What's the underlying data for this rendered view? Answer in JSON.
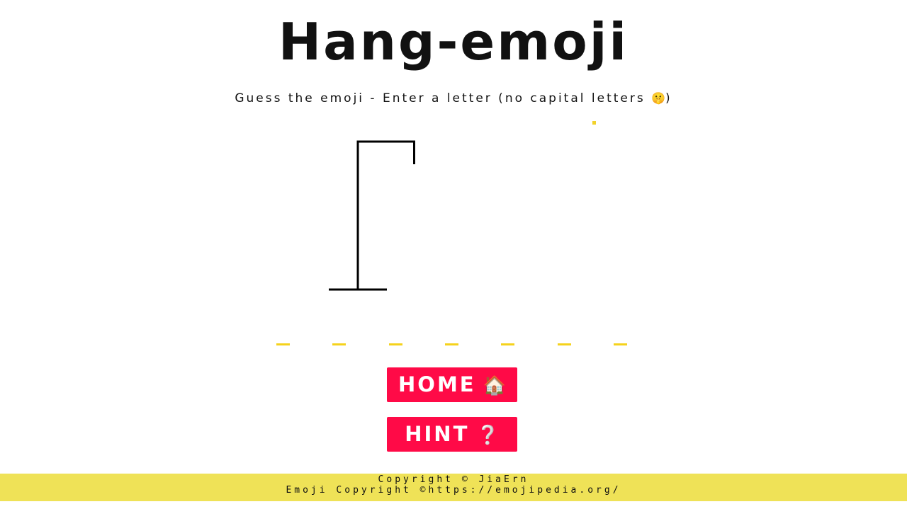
{
  "title": "Hang-emoji",
  "instruction": {
    "text": "Guess the emoji - Enter a letter (no capital letters ",
    "emoji": "🤫",
    "close": ")"
  },
  "game": {
    "slot_count": 7,
    "slot_color": "#f5d21c"
  },
  "buttons": {
    "home": {
      "label": "HOME",
      "icon": "🏠"
    },
    "hint": {
      "label": "HINT",
      "icon": "❔"
    }
  },
  "footer": {
    "line1": "Copyright © JiaErn",
    "line2": "Emoji Copyright ©https://emojipedia.org/"
  },
  "colors": {
    "button": "#ff0a47",
    "footer": "#efe257",
    "accent": "#f2d22a"
  }
}
